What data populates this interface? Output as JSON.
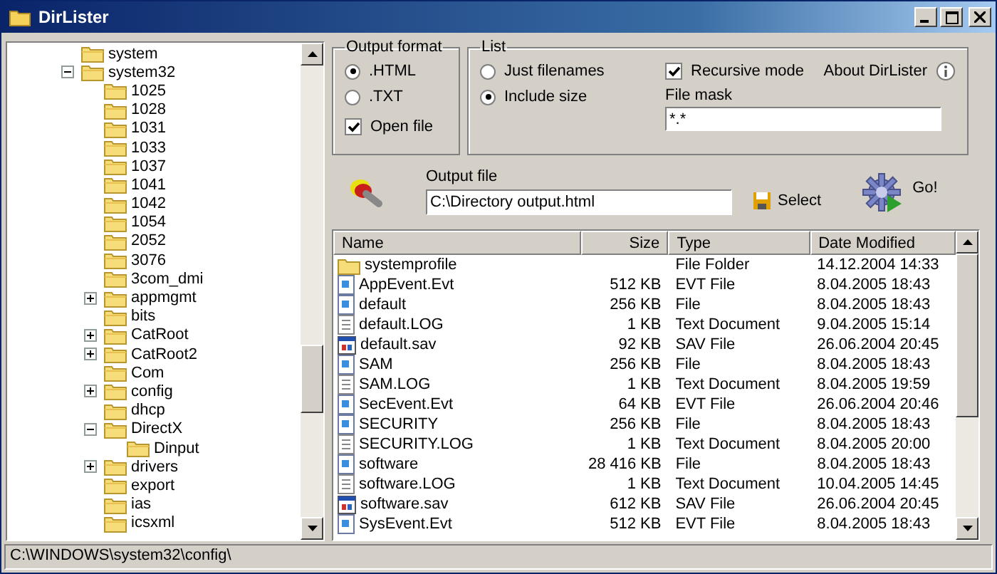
{
  "window": {
    "title": "DirLister"
  },
  "tree": [
    {
      "label": "system"
    },
    {
      "label": "system32",
      "expanded": true,
      "children": [
        {
          "label": "1025"
        },
        {
          "label": "1028"
        },
        {
          "label": "1031"
        },
        {
          "label": "1033"
        },
        {
          "label": "1037"
        },
        {
          "label": "1041"
        },
        {
          "label": "1042"
        },
        {
          "label": "1054"
        },
        {
          "label": "2052"
        },
        {
          "label": "3076"
        },
        {
          "label": "3com_dmi"
        },
        {
          "label": "appmgmt",
          "expanded": false
        },
        {
          "label": "bits"
        },
        {
          "label": "CatRoot",
          "expanded": false
        },
        {
          "label": "CatRoot2",
          "expanded": false
        },
        {
          "label": "Com"
        },
        {
          "label": "config",
          "expanded": false
        },
        {
          "label": "dhcp"
        },
        {
          "label": "DirectX",
          "expanded": true,
          "children": [
            {
              "label": "Dinput"
            }
          ]
        },
        {
          "label": "drivers",
          "expanded": false
        },
        {
          "label": "export"
        },
        {
          "label": "ias"
        },
        {
          "label": "icsxml"
        }
      ]
    }
  ],
  "output_format": {
    "title": "Output format",
    "options": [
      {
        "label": ".HTML",
        "selected": true
      },
      {
        "label": ".TXT",
        "selected": false
      }
    ],
    "open_file": {
      "label": "Open file",
      "checked": true
    }
  },
  "list": {
    "title": "List",
    "options": [
      {
        "label": "Just filenames",
        "selected": false
      },
      {
        "label": "Include size",
        "selected": true
      }
    ],
    "recursive": {
      "label": "Recursive mode",
      "checked": true
    },
    "about": "About DirLister",
    "file_mask_label": "File mask",
    "file_mask": "*.*"
  },
  "output_file": {
    "label": "Output file",
    "value": "C:\\Directory output.html"
  },
  "select_button": "Select",
  "go_button": "Go!",
  "table": {
    "columns": [
      "Name",
      "Size",
      "Type",
      "Date Modified"
    ],
    "rows": [
      {
        "kind": "folder",
        "name": "systemprofile",
        "size": "",
        "type": "File Folder",
        "date": "14.12.2004 14:33"
      },
      {
        "kind": "file",
        "name": "AppEvent.Evt",
        "size": "512 KB",
        "type": "EVT File",
        "date": "8.04.2005 18:43"
      },
      {
        "kind": "file",
        "name": "default",
        "size": "256 KB",
        "type": "File",
        "date": "8.04.2005 18:43"
      },
      {
        "kind": "text",
        "name": "default.LOG",
        "size": "1 KB",
        "type": "Text Document",
        "date": "9.04.2005 15:14"
      },
      {
        "kind": "sav",
        "name": "default.sav",
        "size": "92 KB",
        "type": "SAV File",
        "date": "26.06.2004 20:45"
      },
      {
        "kind": "file",
        "name": "SAM",
        "size": "256 KB",
        "type": "File",
        "date": "8.04.2005 18:43"
      },
      {
        "kind": "text",
        "name": "SAM.LOG",
        "size": "1 KB",
        "type": "Text Document",
        "date": "8.04.2005 19:59"
      },
      {
        "kind": "file",
        "name": "SecEvent.Evt",
        "size": "64 KB",
        "type": "EVT File",
        "date": "26.06.2004 20:46"
      },
      {
        "kind": "file",
        "name": "SECURITY",
        "size": "256 KB",
        "type": "File",
        "date": "8.04.2005 18:43"
      },
      {
        "kind": "text",
        "name": "SECURITY.LOG",
        "size": "1 KB",
        "type": "Text Document",
        "date": "8.04.2005 20:00"
      },
      {
        "kind": "file",
        "name": "software",
        "size": "28 416 KB",
        "type": "File",
        "date": "8.04.2005 18:43"
      },
      {
        "kind": "text",
        "name": "software.LOG",
        "size": "1 KB",
        "type": "Text Document",
        "date": "10.04.2005 14:45"
      },
      {
        "kind": "sav",
        "name": "software.sav",
        "size": "612 KB",
        "type": "SAV File",
        "date": "26.06.2004 20:45"
      },
      {
        "kind": "file",
        "name": "SysEvent.Evt",
        "size": "512 KB",
        "type": "EVT File",
        "date": "8.04.2005 18:43"
      }
    ]
  },
  "status_bar": "C:\\WINDOWS\\system32\\config\\"
}
